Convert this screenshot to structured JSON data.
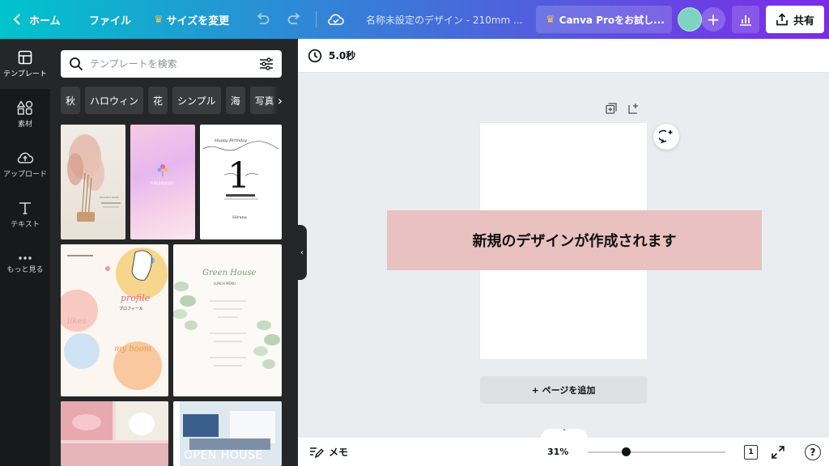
{
  "topbar": {
    "home_label": "ホーム",
    "file_label": "ファイル",
    "resize_label": "サイズを変更",
    "document_title": "名称未設定のデザイン - 210mm ...",
    "pro_label": "Canva Proをお試し...",
    "share_label": "共有"
  },
  "rail": {
    "items": [
      {
        "label": "テンプレート",
        "icon": "template-icon"
      },
      {
        "label": "素材",
        "icon": "elements-icon"
      },
      {
        "label": "アップロード",
        "icon": "upload-icon"
      },
      {
        "label": "テキスト",
        "icon": "text-icon"
      },
      {
        "label": "もっと見る",
        "icon": "more-icon"
      }
    ]
  },
  "panel": {
    "search_placeholder": "テンプレートを検索",
    "chips": [
      "秋",
      "ハロウィン",
      "花",
      "シンプル",
      "海",
      "写真"
    ],
    "templates": [
      {
        "name": "dried-flowers",
        "text": "EXAMPLE NAME"
      },
      {
        "name": "pink-gradient",
        "text": "今日は何の日？"
      },
      {
        "name": "birthday-card",
        "text": "Happy Birthday",
        "number": "1",
        "caption": "Hiruna"
      },
      {
        "name": "profile-card",
        "text": "profile",
        "subtext": "プロフィール",
        "extra": "likes",
        "extra2": "my boom"
      },
      {
        "name": "green-house-menu",
        "text": "Green House",
        "subtext": "LUNCH MENU"
      },
      {
        "name": "pink-photo-collage",
        "text": ""
      },
      {
        "name": "open-house",
        "text": "OPEN HOUSE"
      }
    ]
  },
  "workspace": {
    "timer": "5.0秒",
    "banner_text": "新規のデザインが作成されます",
    "add_page_label": "+ ページを追加"
  },
  "footer": {
    "notes_label": "メモ",
    "zoom": "31%",
    "page_number": "1",
    "help": "?"
  },
  "colors": {
    "gradient_start": "#00c4cc",
    "gradient_end": "#7d2ae8",
    "banner": "#e9c1c0",
    "panel": "#252627",
    "rail": "#18191b"
  }
}
